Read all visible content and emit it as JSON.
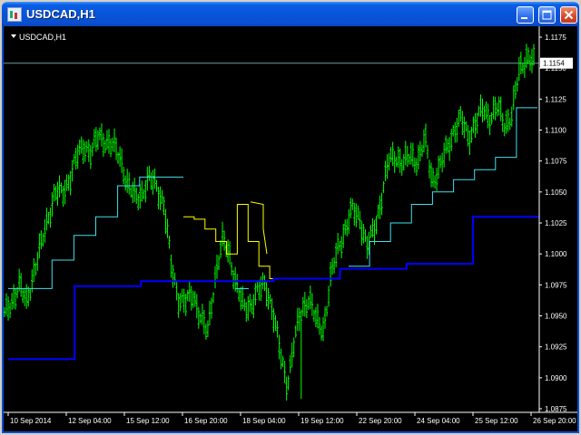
{
  "window": {
    "title": "USDCAD,H1",
    "icon": "chart-app-icon",
    "controls": [
      "minimize-icon",
      "maximize-icon",
      "close-icon"
    ]
  },
  "chart_data": {
    "type": "candlestick",
    "symbol_label": "USDCAD,H1",
    "colors": {
      "background": "#000000",
      "candles": "#00ff00",
      "channel_upper": "#ffff00",
      "channel_lower": "#40e0f0",
      "trend_line": "#0000ff",
      "bid_line": "#6b9aa0",
      "axis": "#ffffff"
    },
    "y_axis": {
      "min": 1.0875,
      "max": 1.1175,
      "ticks": [
        "1.1175",
        "1.1150",
        "1.1125",
        "1.1100",
        "1.1075",
        "1.1050",
        "1.1025",
        "1.1000",
        "1.0975",
        "1.0950",
        "1.0925",
        "1.0900",
        "1.0875"
      ]
    },
    "x_axis": {
      "ticks": [
        "10 Sep 2014",
        "12 Sep 04:00",
        "15 Sep 12:00",
        "16 Sep 20:00",
        "18 Sep 04:00",
        "19 Sep 12:00",
        "22 Sep 20:00",
        "24 Sep 04:00",
        "25 Sep 12:00",
        "26 Sep 20:00"
      ]
    },
    "current_price": "1.1154",
    "grid": false,
    "price_series": [
      1.095,
      1.0962,
      1.0975,
      1.096,
      1.0985,
      1.1005,
      1.103,
      1.105,
      1.1048,
      1.1062,
      1.1078,
      1.1088,
      1.1082,
      1.1095,
      1.1092,
      1.1086,
      1.1078,
      1.1055,
      1.1045,
      1.105,
      1.106,
      1.1055,
      1.104,
      1.099,
      1.0965,
      1.096,
      1.0968,
      1.095,
      1.0935,
      1.098,
      1.101,
      1.1,
      1.0975,
      1.0955,
      1.096,
      1.097,
      1.0975,
      1.0955,
      1.092,
      1.0895,
      1.093,
      1.0955,
      1.0965,
      1.0945,
      1.094,
      1.098,
      1.1005,
      1.102,
      1.1035,
      1.103,
      1.1005,
      1.102,
      1.1045,
      1.1075,
      1.108,
      1.1072,
      1.108,
      1.1075,
      1.1092,
      1.106,
      1.1068,
      1.1085,
      1.11,
      1.1108,
      1.1095,
      1.1105,
      1.1118,
      1.111,
      1.1118,
      1.1105,
      1.1112,
      1.1148,
      1.116,
      1.1154
    ],
    "channel_lower": {
      "x_range": [
        "10 Sep 2014",
        "16 Sep 20:00"
      ],
      "values": [
        1.0972,
        1.0972,
        1.0995,
        1.1015,
        1.103,
        1.1055,
        1.1062,
        1.1062
      ],
      "x_range_2": [
        "22 Sep 20:00",
        "26 Sep 20:00"
      ],
      "values_2": [
        1.099,
        1.101,
        1.1025,
        1.104,
        1.105,
        1.106,
        1.1068,
        1.1078,
        1.1118
      ]
    },
    "channel_upper": {
      "values": [
        1.103,
        1.1028,
        1.102,
        1.101,
        1.1,
        1.104,
        1.101,
        1.099,
        1.098
      ]
    },
    "trend_line": {
      "values": [
        1.0915,
        1.0915,
        1.0974,
        1.0974,
        1.0978,
        1.0978,
        1.0978,
        1.0978,
        1.098,
        1.098,
        1.0988,
        1.0988,
        1.0992,
        1.0992,
        1.103,
        1.103
      ]
    }
  }
}
